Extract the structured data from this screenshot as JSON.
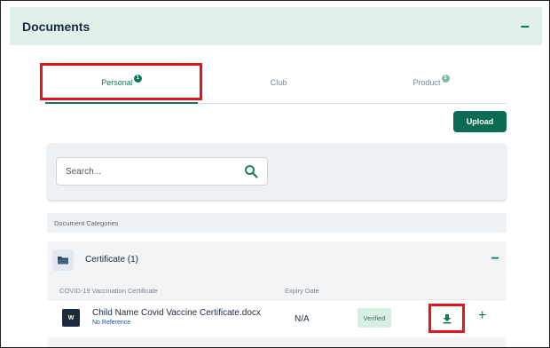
{
  "header": {
    "title": "Documents",
    "collapse_glyph": "−"
  },
  "tabs": [
    {
      "label": "Personal",
      "badge": "1",
      "active": true
    },
    {
      "label": "Club",
      "badge": "",
      "active": false
    },
    {
      "label": "Product",
      "badge": "1",
      "active": false
    }
  ],
  "upload_label": "Upload",
  "search": {
    "placeholder": "Search...",
    "icon": "search-icon"
  },
  "categories_header": "Document Categories",
  "category": {
    "title": "Certificate (1)",
    "icon": "folder-icon",
    "collapse_glyph": "−",
    "columns": {
      "name": "COVID-19 Vaccination Certificate",
      "expiry": "Expiry Date"
    },
    "document": {
      "file_badge": "W",
      "name": "Child Name Covid Vaccine Certificate.docx",
      "reference": "No Reference",
      "expiry": "N/A",
      "status": "Verified",
      "add_glyph": "+"
    }
  },
  "colors": {
    "accent": "#0b7a5c",
    "button": "#0b6b53",
    "highlight": "#e0161b",
    "header_bg": "#dff1ea"
  }
}
